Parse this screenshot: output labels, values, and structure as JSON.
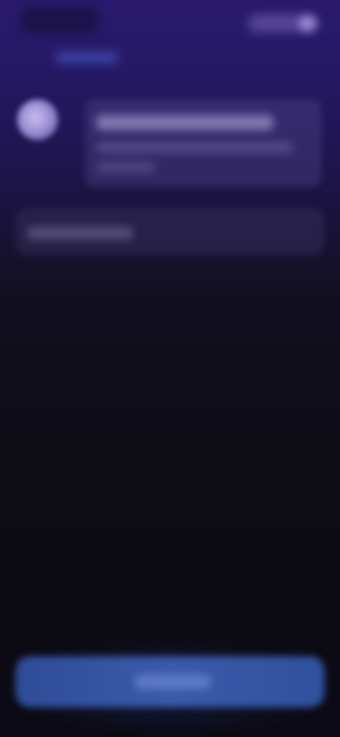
{
  "colors": {
    "background_top": "#2a1a6e",
    "background_bottom": "#0b0a14",
    "button": "#3a5aaa",
    "avatar": "#9d8fd6"
  },
  "icons": {
    "avatar": "avatar-circle",
    "header_action": "pill-toggle"
  },
  "header": {},
  "message": {},
  "input": {},
  "primary_button": {}
}
